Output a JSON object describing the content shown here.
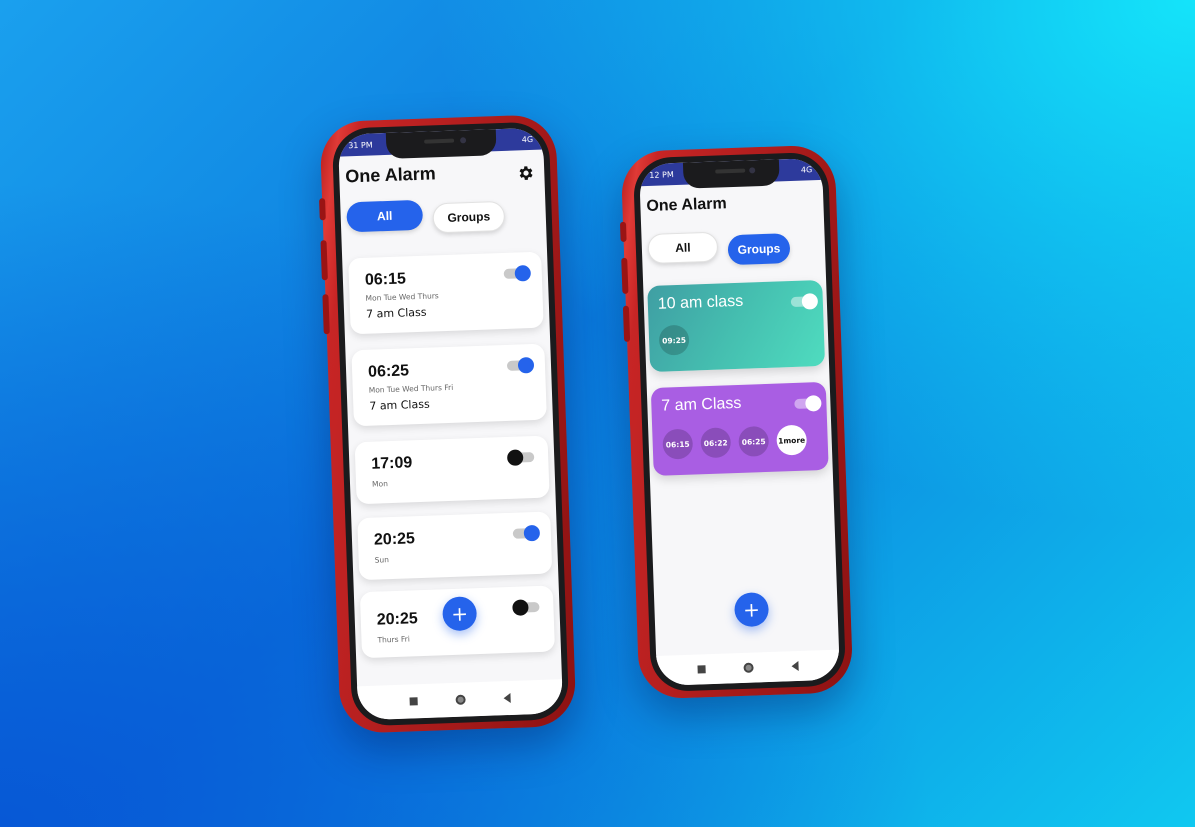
{
  "colors": {
    "accent": "#2563eb",
    "status_bar": "#2d3a9c",
    "group_teal_start": "#3f9ea3",
    "group_teal_end": "#4fdcbf",
    "group_purple": "#a95ee3",
    "phone_frame": "#c72525"
  },
  "phone_left": {
    "status": {
      "time": "31 PM",
      "network": "4G"
    },
    "title": "One Alarm",
    "settings_icon": "gear-icon",
    "tabs": [
      {
        "label": "All",
        "active": true
      },
      {
        "label": "Groups",
        "active": false
      }
    ],
    "alarms": [
      {
        "time": "06:15",
        "days": "Mon Tue Wed Thurs",
        "label": "7 am Class",
        "enabled": true
      },
      {
        "time": "06:25",
        "days": "Mon Tue Wed Thurs Fri",
        "label": "7 am Class",
        "enabled": true
      },
      {
        "time": "17:09",
        "days": "Mon",
        "label": "",
        "enabled": false
      },
      {
        "time": "20:25",
        "days": "Sun",
        "label": "",
        "enabled": true
      },
      {
        "time": "20:25",
        "days": "Thurs Fri",
        "label": "",
        "enabled": false
      }
    ],
    "fab_icon": "+"
  },
  "phone_right": {
    "status": {
      "time": "12 PM",
      "network": "4G"
    },
    "title": "One Alarm",
    "tabs": [
      {
        "label": "All",
        "active": false
      },
      {
        "label": "Groups",
        "active": true
      }
    ],
    "groups": [
      {
        "name": "10 am class",
        "enabled": true,
        "times": [
          "09:25"
        ]
      },
      {
        "name": "7 am Class",
        "enabled": true,
        "times": [
          "06:15",
          "06:22",
          "06:25"
        ],
        "more": "1more"
      }
    ],
    "fab_icon": "+"
  }
}
